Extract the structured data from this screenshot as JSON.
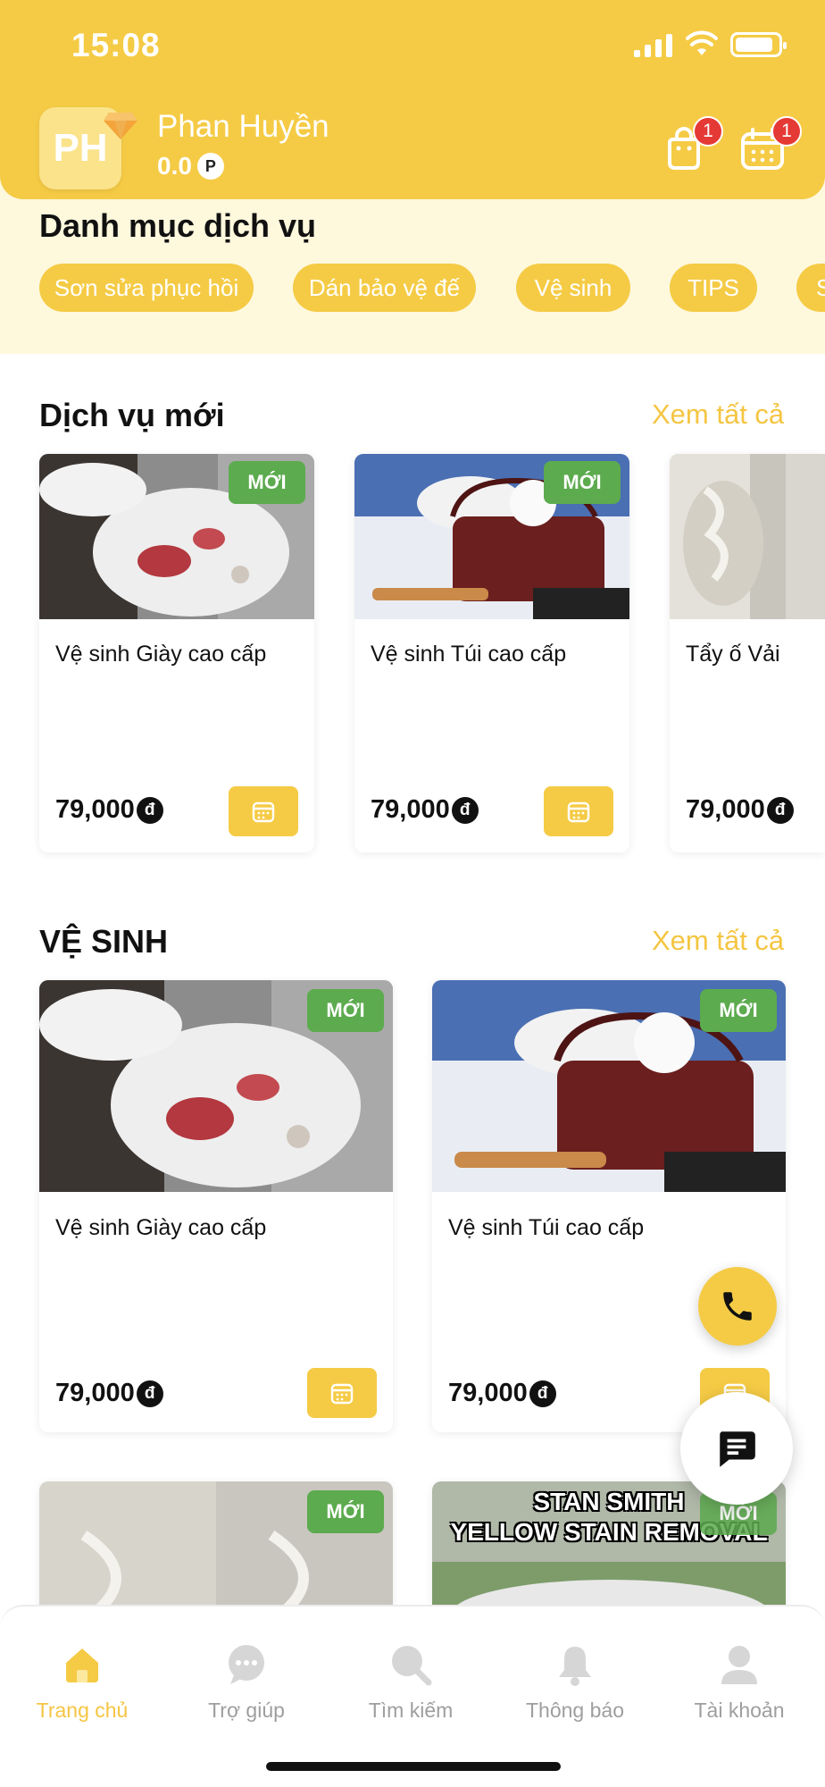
{
  "status_bar": {
    "time": "15:08"
  },
  "user": {
    "initials": "PH",
    "name": "Phan Huyền",
    "points": "0.0",
    "points_unit": "P"
  },
  "header_icons": {
    "cart_badge": "1",
    "calendar_badge": "1"
  },
  "categories": {
    "title": "Danh mục dịch vụ",
    "chips": [
      "Sơn sửa phục hồi",
      "Dán bảo vệ đế",
      "Vệ sinh",
      "TIPS",
      "S"
    ]
  },
  "new_services": {
    "title": "Dịch vụ mới",
    "see_all": "Xem tất cả",
    "items": [
      {
        "name": "Vệ sinh Giày cao cấp",
        "price": "79,000",
        "currency": "đ",
        "tag": "MỚI"
      },
      {
        "name": "Vệ sinh Túi cao cấp",
        "price": "79,000",
        "currency": "đ",
        "tag": "MỚI"
      },
      {
        "name": "Tẩy ố Vải",
        "price": "79,000",
        "currency": "đ"
      }
    ]
  },
  "cleaning": {
    "title": "VỆ SINH",
    "see_all": "Xem tất cả",
    "items": [
      {
        "name": "Vệ sinh Giày cao cấp",
        "price": "79,000",
        "currency": "đ",
        "tag": "MỚI"
      },
      {
        "name": "Vệ sinh Túi cao cấp",
        "price": "79,000",
        "currency": "đ",
        "tag": "MỚI"
      },
      {
        "tag": "MỚI"
      },
      {
        "tag": "MỚI",
        "image_text_1": "STAN SMITH",
        "image_text_2": "YELLOW STAIN REMOVAL"
      }
    ]
  },
  "bottom_nav": {
    "items": [
      {
        "label": "Trang chủ",
        "icon": "home-icon"
      },
      {
        "label": "Trợ giúp",
        "icon": "chat-bubble-icon"
      },
      {
        "label": "Tìm kiếm",
        "icon": "search-icon"
      },
      {
        "label": "Thông báo",
        "icon": "bell-icon"
      },
      {
        "label": "Tài khoản",
        "icon": "user-icon"
      }
    ]
  },
  "colors": {
    "accent": "#f5cb45",
    "new_tag": "#5cab4e",
    "badge": "#e53935",
    "category_band": "#fef8dd"
  }
}
